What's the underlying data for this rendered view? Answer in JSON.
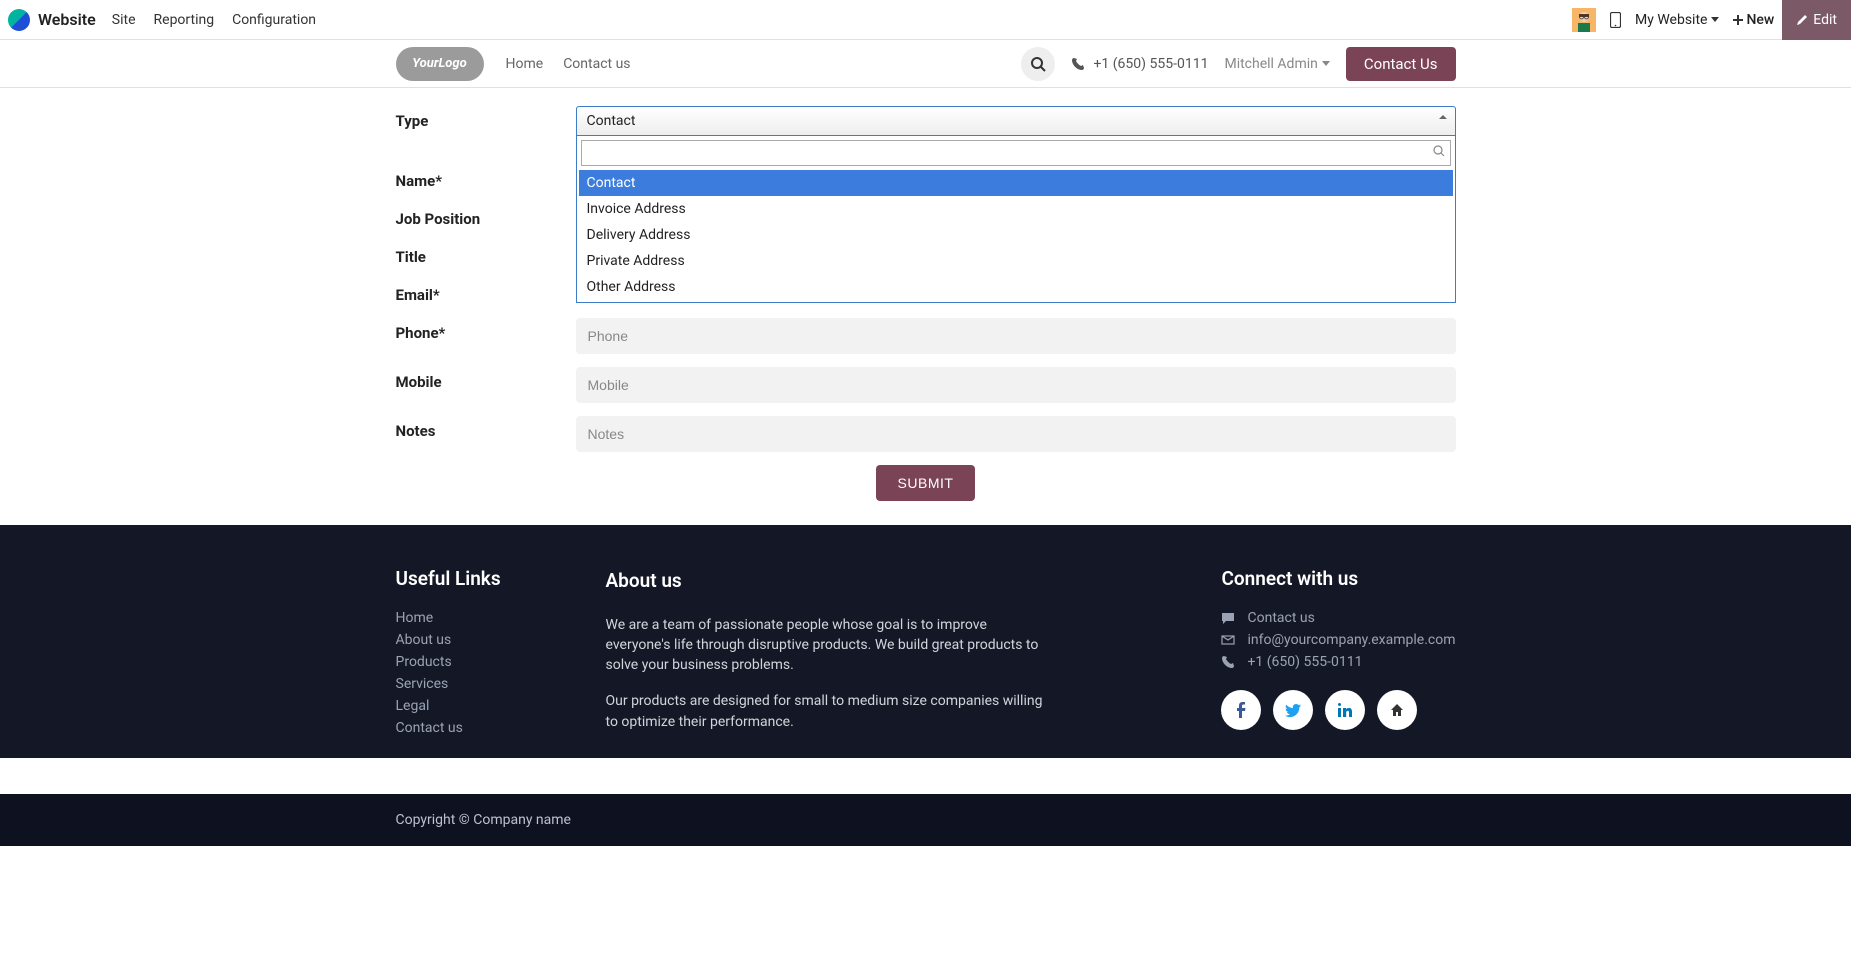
{
  "top_menu": {
    "app_name": "Website",
    "items": [
      "Site",
      "Reporting",
      "Configuration"
    ],
    "my_website": "My Website",
    "new_btn": "New",
    "edit_btn": "Edit"
  },
  "site_nav": {
    "logo_text": "YourLogo",
    "links": {
      "home": "Home",
      "contact": "Contact us"
    },
    "phone": "+1 (650) 555-0111",
    "user": "Mitchell Admin",
    "contact_btn": "Contact Us"
  },
  "form": {
    "labels": {
      "type": "Type",
      "name": "Name*",
      "job": "Job Position",
      "title": "Title",
      "email": "Email*",
      "phone": "Phone*",
      "mobile": "Mobile",
      "notes": "Notes"
    },
    "type_select": {
      "value": "Contact",
      "search": "",
      "options": [
        "Contact",
        "Invoice Address",
        "Delivery Address",
        "Private Address",
        "Other Address"
      ]
    },
    "placeholders": {
      "phone": "Phone",
      "mobile": "Mobile",
      "notes": "Notes"
    },
    "submit": "SUBMIT"
  },
  "footer": {
    "useful_title": "Useful Links",
    "useful_links": [
      "Home",
      "About us",
      "Products",
      "Services",
      "Legal",
      "Contact us"
    ],
    "about_title": "About us",
    "about_p1": "We are a team of passionate people whose goal is to improve everyone's life through disruptive products. We build great products to solve your business problems.",
    "about_p2": "Our products are designed for small to medium size companies willing to optimize their performance.",
    "connect_title": "Connect with us",
    "contact_us": "Contact us",
    "email": "info@yourcompany.example.com",
    "phone": "+1 (650) 555-0111",
    "copyright": "Copyright © Company name"
  }
}
